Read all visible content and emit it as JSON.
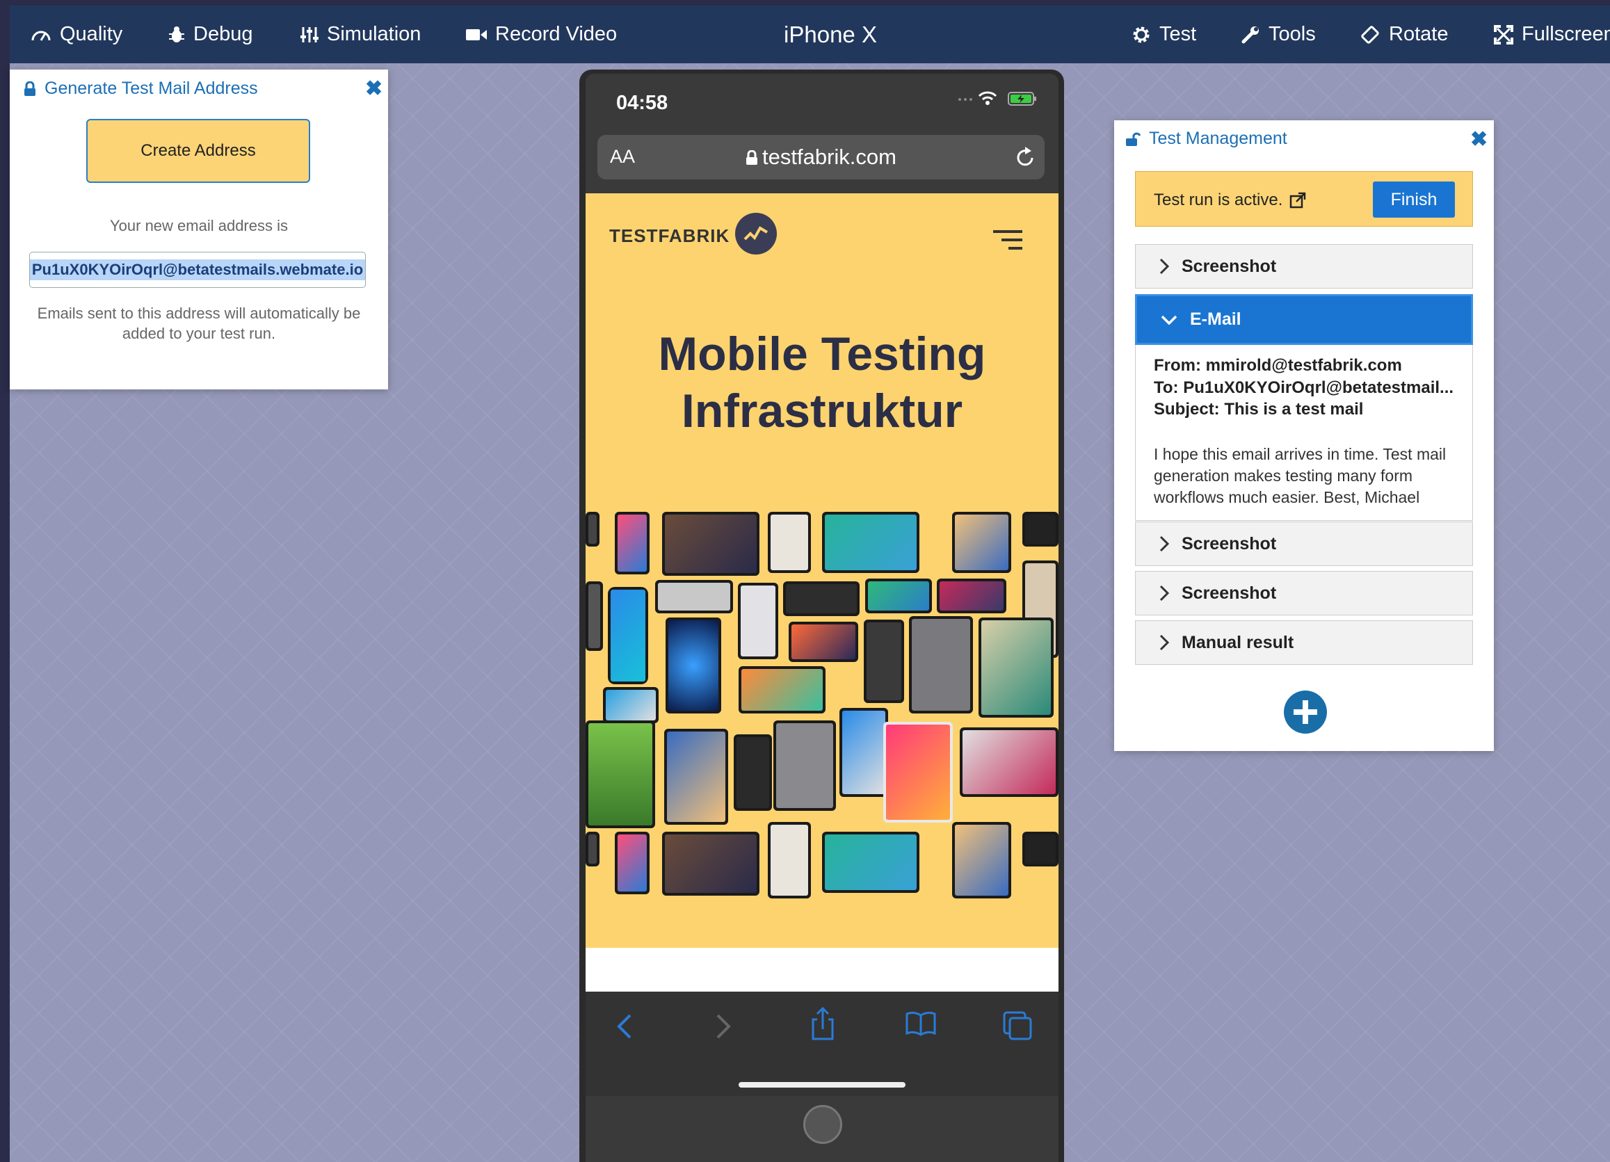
{
  "toolbar": {
    "quality": "Quality",
    "debug": "Debug",
    "simulation": "Simulation",
    "record_video": "Record Video",
    "device_title": "iPhone X",
    "test": "Test",
    "tools": "Tools",
    "rotate": "Rotate",
    "fullscreen": "Fullscreen"
  },
  "mail_panel": {
    "title": "Generate Test Mail Address",
    "create_button": "Create Address",
    "new_address_label": "Your new email address is",
    "email_value": "Pu1uX0KYOirOqrl@betatestmails.webmate.io",
    "note_line1": "Emails sent to this address will automatically be",
    "note_line2": "added to your test run."
  },
  "phone": {
    "time": "04:58",
    "aa_label": "AA",
    "url": "testfabrik.com",
    "logo_text": "TESTFABRIK",
    "headline_line1": "Mobile Testing",
    "headline_line2": "Infrastruktur"
  },
  "test_panel": {
    "title": "Test Management",
    "active_text": "Test run is active.",
    "finish_button": "Finish",
    "sections": [
      "Screenshot",
      "E-Mail",
      "Screenshot",
      "Screenshot",
      "Manual result"
    ],
    "email": {
      "from": "From: mmirold@testfabrik.com",
      "to": "To: Pu1uX0KYOirOqrl@betatestmail...",
      "subject": "Subject: This is a test mail",
      "body": "I hope this email arrives in time. Test mail generation makes testing many form workflows much easier. Best, Michael"
    }
  },
  "colors": {
    "toolbar_bg": "#22375c",
    "accent_blue": "#1a75d2",
    "highlight_yellow": "#fcd476",
    "site_yellow": "#fdd36f"
  }
}
